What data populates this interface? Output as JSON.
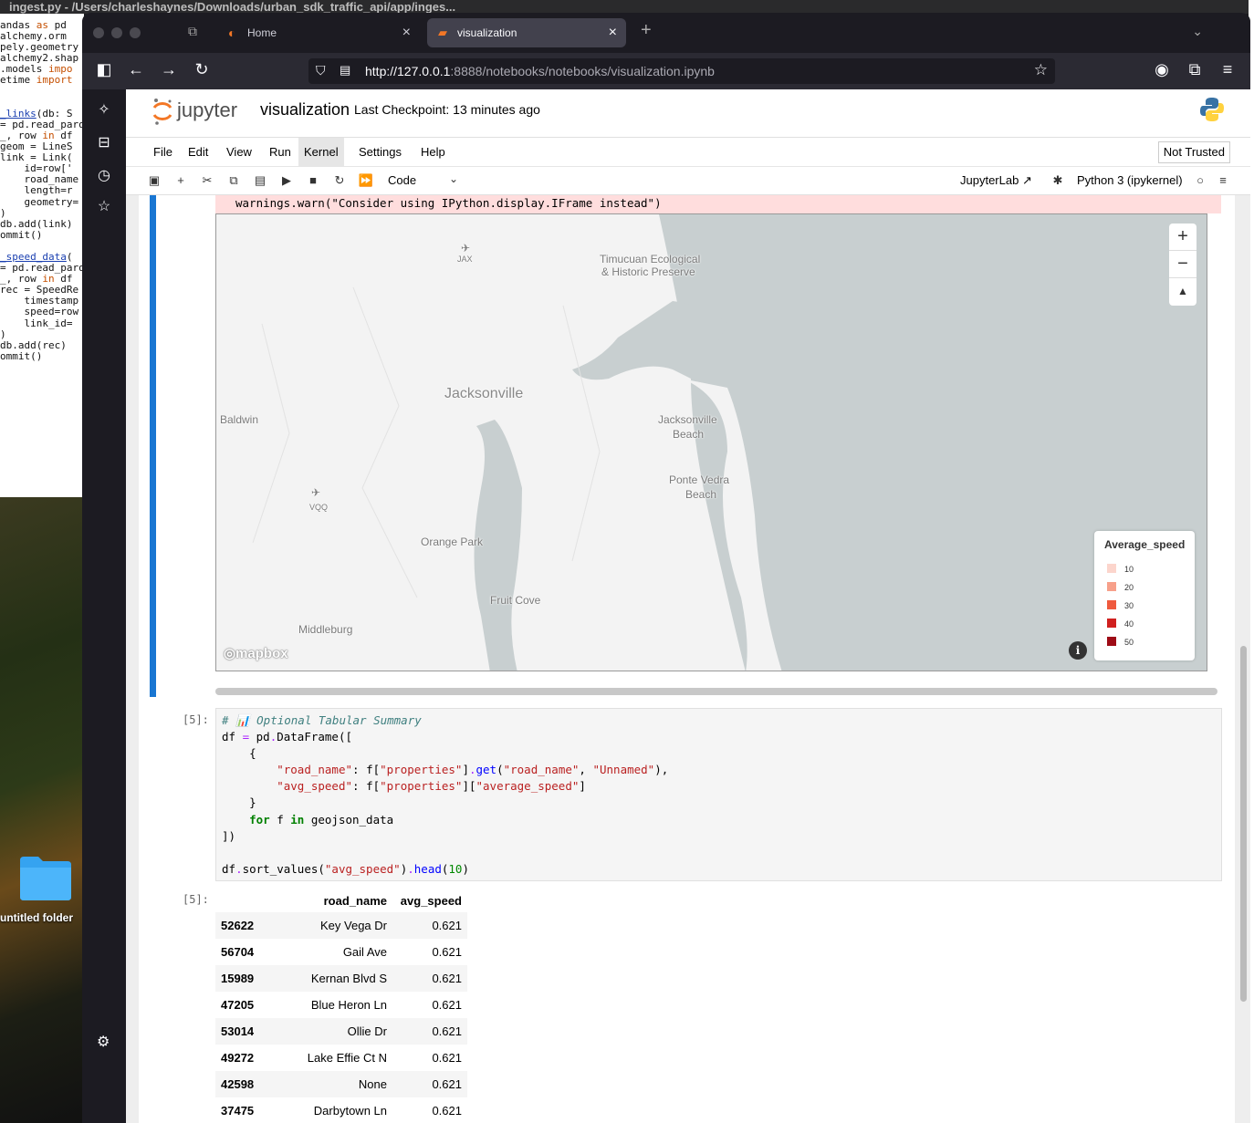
{
  "background": {
    "editor_title": "ingest.py - /Users/charleshaynes/Downloads/urban_sdk_traffic_api/app/inges...",
    "code_lines": [
      {
        "pre": "",
        "kw": "",
        "rest": "andas ",
        "kw2": "as",
        "post": " pd"
      },
      {
        "pre": "",
        "kw": "",
        "rest": "alchemy.orm",
        "kw2": "",
        "post": ""
      },
      {
        "pre": "",
        "kw": "",
        "rest": "pely.geometry",
        "kw2": "",
        "post": ""
      },
      {
        "pre": "",
        "kw": "",
        "rest": "alchemy2.shap",
        "kw2": "",
        "post": ""
      },
      {
        "pre": "",
        "kw": "",
        "rest": ".models ",
        "kw2": "impo",
        "post": ""
      },
      {
        "pre": "",
        "kw": "",
        "rest": "etime ",
        "kw2": "import",
        "post": ""
      },
      {
        "pre": "",
        "kw": "",
        "rest": "",
        "kw2": "",
        "post": ""
      },
      {
        "pre": "",
        "kw": "",
        "rest": "",
        "kw2": "",
        "post": ""
      },
      {
        "pre": "",
        "fn": "_links",
        "rest": "(db: S",
        "kw2": "",
        "post": ""
      },
      {
        "pre": "= pd.read_parq",
        "kw": "",
        "rest": "",
        "kw2": "",
        "post": ""
      },
      {
        "pre": "_, row ",
        "kw": "in",
        "rest": " df",
        "kw2": "",
        "post": ""
      },
      {
        "pre": "geom = LineS",
        "kw": "",
        "rest": "",
        "kw2": "",
        "post": ""
      },
      {
        "pre": "link = Link(",
        "kw": "",
        "rest": "",
        "kw2": "",
        "post": ""
      },
      {
        "pre": "    id=row['",
        "kw": "",
        "rest": "",
        "kw2": "",
        "post": ""
      },
      {
        "pre": "    road_name",
        "kw": "",
        "rest": "",
        "kw2": "",
        "post": ""
      },
      {
        "pre": "    length=r",
        "kw": "",
        "rest": "",
        "kw2": "",
        "post": ""
      },
      {
        "pre": "    geometry=",
        "kw": "",
        "rest": "",
        "kw2": "",
        "post": ""
      },
      {
        "pre": ")",
        "kw": "",
        "rest": "",
        "kw2": "",
        "post": ""
      },
      {
        "pre": "db.add(link)",
        "kw": "",
        "rest": "",
        "kw2": "",
        "post": ""
      },
      {
        "pre": "ommit()",
        "kw": "",
        "rest": "",
        "kw2": "",
        "post": ""
      },
      {
        "pre": "",
        "kw": "",
        "rest": "",
        "kw2": "",
        "post": ""
      },
      {
        "pre": "",
        "fn": "_speed_data",
        "rest": "(",
        "kw2": "",
        "post": ""
      },
      {
        "pre": "= pd.read_parq",
        "kw": "",
        "rest": "",
        "kw2": "",
        "post": ""
      },
      {
        "pre": "_, row ",
        "kw": "in",
        "rest": " df",
        "kw2": "",
        "post": ""
      },
      {
        "pre": "rec = SpeedRe",
        "kw": "",
        "rest": "",
        "kw2": "",
        "post": ""
      },
      {
        "pre": "    timestamp",
        "kw": "",
        "rest": "",
        "kw2": "",
        "post": ""
      },
      {
        "pre": "    speed=row",
        "kw": "",
        "rest": "",
        "kw2": "",
        "post": ""
      },
      {
        "pre": "    link_id=",
        "kw": "",
        "rest": "",
        "kw2": "",
        "post": ""
      },
      {
        "pre": ")",
        "kw": "",
        "rest": "",
        "kw2": "",
        "post": ""
      },
      {
        "pre": "db.add(rec)",
        "kw": "",
        "rest": "",
        "kw2": "",
        "post": ""
      },
      {
        "pre": "ommit()",
        "kw": "",
        "rest": "",
        "kw2": "",
        "post": ""
      }
    ],
    "desktop_folder_label": "untitled folder"
  },
  "browser": {
    "tabs": [
      {
        "label": "Home",
        "close": "×"
      },
      {
        "label": "visualization",
        "close": "×"
      }
    ],
    "new_tab": "+",
    "url_host": "http://127.0.0.1",
    "url_rest": ":8888/notebooks/notebooks/visualization.ipynb"
  },
  "jupyter": {
    "logo_text": "jupyter",
    "notebook_title": "visualization",
    "checkpoint": "Last Checkpoint: 13 minutes ago",
    "menus": [
      "File",
      "Edit",
      "View",
      "Run",
      "Kernel",
      "Settings",
      "Help"
    ],
    "trust": "Not Trusted",
    "cell_type": "Code",
    "jupyterlab_link": "JupyterLab",
    "kernel_name": "Python 3 (ipykernel)"
  },
  "output_cell": {
    "warning_text": "warnings.warn(\"Consider using IPython.display.IFrame instead\")",
    "map": {
      "labels": [
        "Timucuan Ecological",
        "& Historic Preserve",
        "Jacksonville",
        "Jacksonville",
        "Beach",
        "Baldwin",
        "Ponte Vedra",
        "Beach",
        "Orange Park",
        "Fruit Cove",
        "Middleburg",
        "JAX",
        "VQQ"
      ],
      "zoom_in": "+",
      "zoom_out": "−",
      "compass": "▲",
      "attribution_logo": "mapbox",
      "info": "i",
      "legend": {
        "title": "Average_speed",
        "items": [
          {
            "label": "10",
            "color": "#fcd5cc"
          },
          {
            "label": "20",
            "color": "#f7a08a"
          },
          {
            "label": "30",
            "color": "#ef5a3e"
          },
          {
            "label": "40",
            "color": "#d0201f"
          },
          {
            "label": "50",
            "color": "#9e0b16"
          }
        ]
      }
    }
  },
  "code_cell": {
    "prompt": "[5]:",
    "comment": "# 📊 Optional Tabular Summary",
    "output_prompt": "[5]:"
  },
  "table": {
    "columns": [
      "",
      "road_name",
      "avg_speed"
    ],
    "rows": [
      [
        "52622",
        "Key Vega Dr",
        "0.621"
      ],
      [
        "56704",
        "Gail Ave",
        "0.621"
      ],
      [
        "15989",
        "Kernan Blvd S",
        "0.621"
      ],
      [
        "47205",
        "Blue Heron Ln",
        "0.621"
      ],
      [
        "53014",
        "Ollie Dr",
        "0.621"
      ],
      [
        "49272",
        "Lake Effie Ct N",
        "0.621"
      ],
      [
        "42598",
        "None",
        "0.621"
      ],
      [
        "37475",
        "Darbytown Ln",
        "0.621"
      ]
    ]
  }
}
